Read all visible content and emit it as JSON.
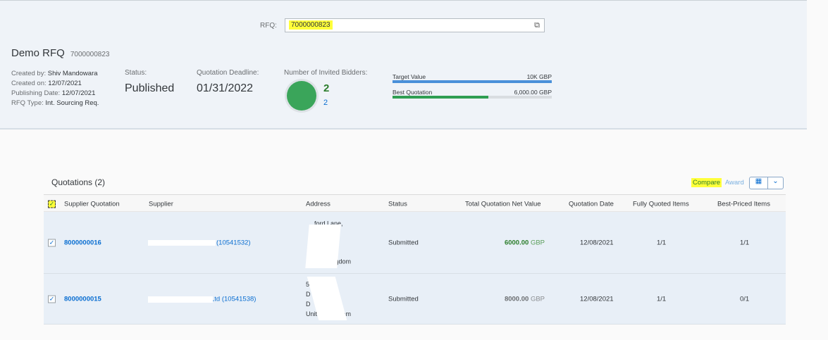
{
  "rfq_field": {
    "label": "RFQ:",
    "value": "7000000823"
  },
  "header": {
    "title": "Demo RFQ",
    "id": "7000000823",
    "meta": [
      {
        "label": "Created by:",
        "value": "Shiv Mandowara"
      },
      {
        "label": "Created on:",
        "value": "12/07/2021"
      },
      {
        "label": "Publishing Date:",
        "value": "12/07/2021"
      },
      {
        "label": "RFQ Type:",
        "value": "Int. Sourcing Req."
      }
    ],
    "status_label": "Status:",
    "status": "Published",
    "deadline_label": "Quotation Deadline:",
    "deadline": "01/31/2022",
    "bidders_label": "Number of Invited Bidders:",
    "bidders_total": "2",
    "bidders_sub": "2",
    "target_label": "Target Value",
    "target_value": "10K GBP",
    "target_fraction": 1.0,
    "best_label": "Best Quotation",
    "best_value": "6,000.00 GBP",
    "best_fraction": 0.6,
    "colors": {
      "target": "#4a90d9",
      "best": "#2f9e52",
      "circle": "#3aa55a"
    }
  },
  "quotations": {
    "title": "Quotations (2)",
    "compare": "Compare",
    "award": "Award",
    "columns": [
      "Supplier Quotation",
      "Supplier",
      "Address",
      "Status",
      "Total Quotation Net Value",
      "Quotation Date",
      "Fully Quoted Items",
      "Best-Priced Items"
    ],
    "rows": [
      {
        "id": "8000000016",
        "supplier": "(10541532)",
        "address": [
          "ford Lane,",
          "",
          "",
          "",
          "United Kingdom"
        ],
        "status": "Submitted",
        "value": "6000.00",
        "currency": "GBP",
        "date": "12/08/2021",
        "fully": "1/1",
        "best": "1/1",
        "value_color": "#2b7d2b"
      },
      {
        "id": "8000000015",
        "supplier": "Ltd (10541538)",
        "address": [
          "5",
          "D",
          "D",
          "United Kingdom"
        ],
        "status": "Submitted",
        "value": "8000.00",
        "currency": "GBP",
        "date": "12/08/2021",
        "fully": "1/1",
        "best": "0/1",
        "value_color": "#32363a"
      }
    ]
  }
}
